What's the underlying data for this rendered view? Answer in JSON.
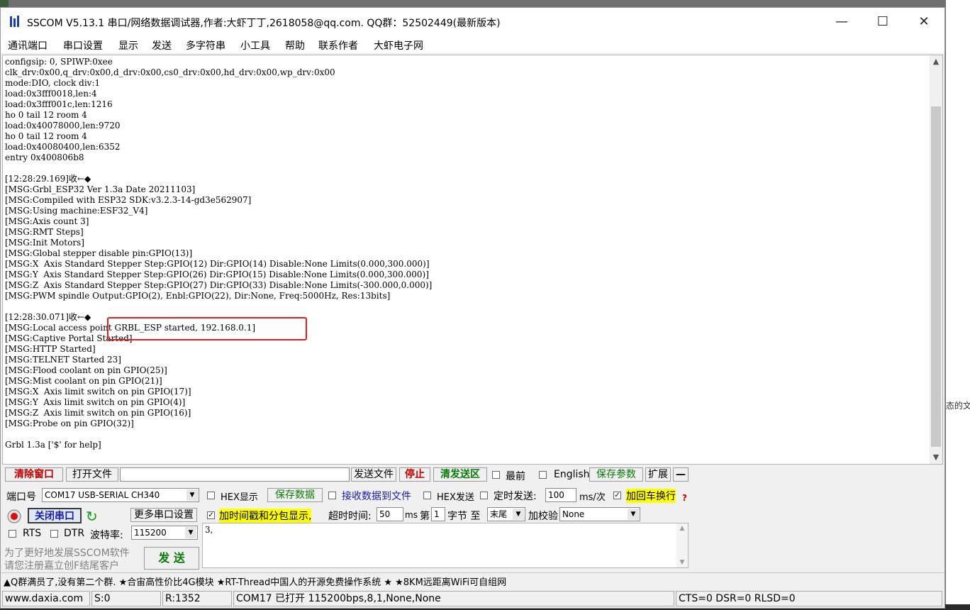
{
  "window": {
    "title": "SSCOM V5.13.1 串口/网络数据调试器,作者:大虾丁丁,2618058@qq.com. QQ群：52502449(最新版本)",
    "minimize": "—",
    "maximize": "☐",
    "close": "✕"
  },
  "menu": [
    "通讯端口",
    "串口设置",
    "显示",
    "发送",
    "多字符串",
    "小工具",
    "帮助",
    "联系作者",
    "大虾电子网"
  ],
  "console": {
    "text": "configsip: 0, SPIWP:0xee\nclk_drv:0x00,q_drv:0x00,d_drv:0x00,cs0_drv:0x00,hd_drv:0x00,wp_drv:0x00\nmode:DIO, clock div:1\nload:0x3fff0018,len:4\nload:0x3fff001c,len:1216\nho 0 tail 12 room 4\nload:0x40078000,len:9720\nho 0 tail 12 room 4\nload:0x40080400,len:6352\nentry 0x400806b8\n\n[12:28:29.169]收←◆\n[MSG:Grbl_ESP32 Ver 1.3a Date 20211103]\n[MSG:Compiled with ESP32 SDK:v3.2.3-14-gd3e562907]\n[MSG:Using machine:ESF32_V4]\n[MSG:Axis count 3]\n[MSG:RMT Steps]\n[MSG:Init Motors]\n[MSG:Global stepper disable pin:GPIO(13)]\n[MSG:X  Axis Standard Stepper Step:GPIO(12) Dir:GPIO(14) Disable:None Limits(0.000,300.000)]\n[MSG:Y  Axis Standard Stepper Step:GPIO(26) Dir:GPIO(15) Disable:None Limits(0.000,300.000)]\n[MSG:Z  Axis Standard Stepper Step:GPIO(27) Dir:GPIO(33) Disable:None Limits(-300.000,0.000)]\n[MSG:PWM spindle Output:GPIO(2), Enbl:GPIO(22), Dir:None, Freq:5000Hz, Res:13bits]\n\n[12:28:30.071]收←◆\n[MSG:Local access point GRBL_ESP started, 192.168.0.1]\n[MSG:Captive Portal Started]\n[MSG:HTTP Started]\n[MSG:TELNET Started 23]\n[MSG:Flood coolant on pin GPIO(25)]\n[MSG:Mist coolant on pin GPIO(21)]\n[MSG:X  Axis limit switch on pin GPIO(17)]\n[MSG:Y  Axis limit switch on pin GPIO(4)]\n[MSG:Z  Axis limit switch on pin GPIO(16)]\n[MSG:Probe on pin GPIO(32)]\n\nGrbl 1.3a ['$' for help]"
  },
  "toolbar1": {
    "clear": "清除窗口",
    "open_file": "打开文件",
    "file_path": "",
    "send_file": "发送文件",
    "stop": "停止",
    "clear_send": "清发送区",
    "topmost": "最前",
    "english": "English",
    "save_params": "保存参数",
    "expand": "扩展",
    "collapse": "—"
  },
  "toolbar2": {
    "port_label": "端口号",
    "port_value": "COM17 USB-SERIAL CH340",
    "hex_display": "HEX显示",
    "save_data": "保存数据",
    "recv_to_file": "接收数据到文件",
    "hex_send": "HEX发送",
    "timed_send": "定时发送:",
    "interval": "100",
    "interval_unit": "ms/次",
    "add_crlf": "加回车换行",
    "help_mark": "?"
  },
  "toolbar3": {
    "close_port": "关闭串口",
    "more_settings": "更多串口设置",
    "timestamp": "加时间戳和分包显示,",
    "timeout_label": "超时时间:",
    "timeout_value": "50",
    "timeout_unit": "ms",
    "byte_prefix": "第",
    "byte_index": "1",
    "byte_mid": "字节 至",
    "byte_end": "末尾",
    "checksum_label": "加校验",
    "checksum_value": "None"
  },
  "toolbar4": {
    "rts": "RTS",
    "dtr": "DTR",
    "baud_label": "波特率:",
    "baud_value": "115200",
    "send_text": "3,"
  },
  "promo": {
    "line1": "为了更好地发展SSCOM软件",
    "line2": "请您注册嘉立创F结尾客户",
    "send_button": "发  送"
  },
  "marquee": "▲Q群满员了,没有第二个群. ★合宙高性价比4G模块 ★RT-Thread中国人的开源免费操作系统 ★ ★8KM远距离WiFi可自组网",
  "status": {
    "website": "www.daxia.com",
    "sent": "S:0",
    "received": "R:1352",
    "port_status": "COM17 已打开  115200bps,8,1,None,None",
    "lines": "CTS=0 DSR=0 RLSD=0"
  },
  "background": {
    "right_text": "态的文"
  }
}
